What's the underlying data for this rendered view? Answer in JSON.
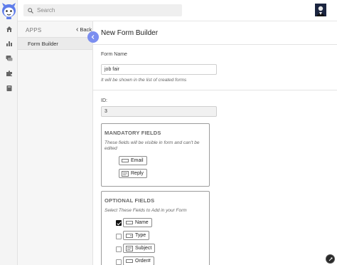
{
  "topbar": {
    "search_placeholder": "Search"
  },
  "apps_panel": {
    "heading": "APPS",
    "back_label": "Back",
    "items": [
      {
        "label": "Form Builder"
      }
    ]
  },
  "main": {
    "title": "New Form Builder",
    "form_name": {
      "label": "Form Name",
      "value": "job fair",
      "hint": "It will be shown in the list of created forms"
    },
    "id_field": {
      "label": "ID:",
      "value": "3"
    },
    "mandatory": {
      "title": "MANDATORY FIELDS",
      "hint": "These fields will be visible in form and can't be edited",
      "fields": [
        {
          "label": "Email"
        },
        {
          "label": "Reply"
        }
      ]
    },
    "optional": {
      "title": "OPTIONAL FIELDS",
      "hint": "Select These Fields to Add in your Form",
      "fields": [
        {
          "label": "Name",
          "checked": true
        },
        {
          "label": "Type",
          "checked": false
        },
        {
          "label": "Subject",
          "checked": false
        },
        {
          "label": "Order#",
          "checked": false
        }
      ]
    }
  },
  "colors": {
    "accent": "#7b8ef0",
    "rail_bg": "#f4f4f4"
  },
  "icons": [
    "logo-icon",
    "home-icon",
    "chart-icon",
    "chat-icon",
    "puzzle-icon",
    "book-icon",
    "search-icon",
    "chevron-left-icon",
    "text-field-icon",
    "textarea-icon",
    "dropdown-icon",
    "help-icon"
  ]
}
